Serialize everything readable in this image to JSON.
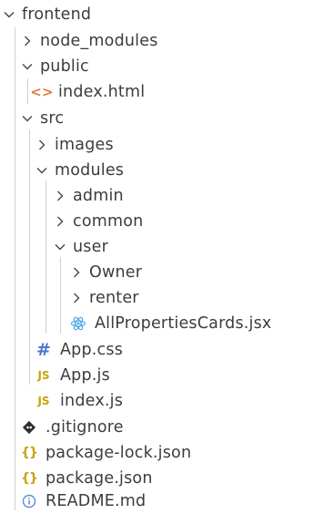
{
  "explorer": {
    "items": [
      {
        "label": "frontend",
        "type": "folder-open"
      },
      {
        "label": "node_modules",
        "type": "folder-closed"
      },
      {
        "label": "public",
        "type": "folder-open"
      },
      {
        "label": "index.html",
        "type": "file",
        "icon": "html-icon"
      },
      {
        "label": "src",
        "type": "folder-open"
      },
      {
        "label": "images",
        "type": "folder-closed"
      },
      {
        "label": "modules",
        "type": "folder-open"
      },
      {
        "label": "admin",
        "type": "folder-closed"
      },
      {
        "label": "common",
        "type": "folder-closed"
      },
      {
        "label": "user",
        "type": "folder-open"
      },
      {
        "label": "Owner",
        "type": "folder-closed"
      },
      {
        "label": "renter",
        "type": "folder-closed"
      },
      {
        "label": "AllPropertiesCards.jsx",
        "type": "file",
        "icon": "react-icon"
      },
      {
        "label": "App.css",
        "type": "file",
        "icon": "css-icon"
      },
      {
        "label": "App.js",
        "type": "file",
        "icon": "js-icon"
      },
      {
        "label": "index.js",
        "type": "file",
        "icon": "js-icon"
      },
      {
        "label": ".gitignore",
        "type": "file",
        "icon": "git-icon"
      },
      {
        "label": "package-lock.json",
        "type": "file",
        "icon": "json-icon"
      },
      {
        "label": "package.json",
        "type": "file",
        "icon": "json-icon"
      },
      {
        "label": "README.md",
        "type": "file",
        "icon": "info-icon"
      }
    ]
  },
  "glyphs": {
    "html": "<>",
    "css": "#",
    "js": "JS",
    "json": "{}"
  },
  "colors": {
    "text": "#3c3c3c",
    "html_icon": "#e37933",
    "css_icon": "#4a78c9",
    "js_icon": "#c8a400",
    "json_icon": "#c8a400",
    "react_icon": "#4ba8e6",
    "info_icon": "#5b8fd6",
    "indent_guide": "#d0d0d0"
  }
}
